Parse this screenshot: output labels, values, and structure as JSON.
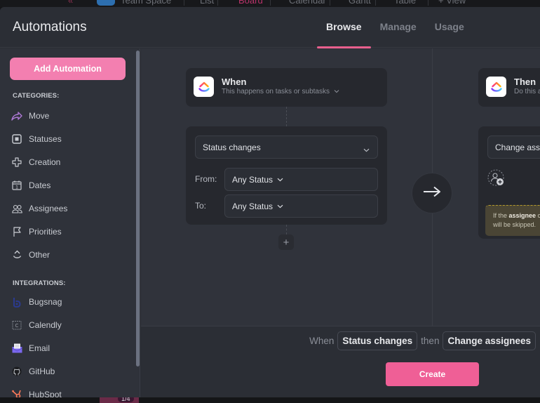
{
  "background_app": {
    "topbar": {
      "collapse_glyph": "«",
      "space_name": "Team Space",
      "views": [
        "List",
        "Board",
        "Calendar",
        "Gantt",
        "Table",
        "+ View"
      ]
    },
    "bottombar": {
      "counter": "1/4"
    }
  },
  "modal": {
    "title": "Automations",
    "tabs": [
      {
        "label": "Browse",
        "active": true
      },
      {
        "label": "Manage",
        "active": false
      },
      {
        "label": "Usage",
        "active": false
      }
    ]
  },
  "sidebar": {
    "add_button": "Add Automation",
    "categories_label": "CATEGORIES:",
    "categories": [
      {
        "label": "Move",
        "icon": "move-arrow-icon"
      },
      {
        "label": "Statuses",
        "icon": "status-square-icon"
      },
      {
        "label": "Creation",
        "icon": "plus-outline-icon"
      },
      {
        "label": "Dates",
        "icon": "calendar-icon"
      },
      {
        "label": "Assignees",
        "icon": "people-icon"
      },
      {
        "label": "Priorities",
        "icon": "flag-icon"
      },
      {
        "label": "Other",
        "icon": "other-icon"
      }
    ],
    "integrations_label": "INTEGRATIONS:",
    "integrations": [
      {
        "label": "Bugsnag",
        "icon": "bugsnag-icon"
      },
      {
        "label": "Calendly",
        "icon": "calendly-icon"
      },
      {
        "label": "Email",
        "icon": "email-icon"
      },
      {
        "label": "GitHub",
        "icon": "github-icon"
      },
      {
        "label": "HubSpot",
        "icon": "hubspot-icon"
      }
    ]
  },
  "builder": {
    "when": {
      "title": "When",
      "subtitle": "This happens on tasks or subtasks",
      "trigger": "Status changes",
      "from_label": "From:",
      "from_value": "Any Status",
      "to_label": "To:",
      "to_value": "Any Status",
      "add_condition": "+"
    },
    "then": {
      "title": "Then",
      "subtitle": "Do this a",
      "action": "Change assig",
      "warning_prefix": "If the ",
      "warning_bold": "assignee",
      "warning_suffix": " c",
      "warning_line2": "will be skipped."
    }
  },
  "footer": {
    "when_word": "When",
    "trigger_chip": "Status changes",
    "then_word": "then",
    "action_chip": "Change assignees",
    "create_button": "Create"
  },
  "colors": {
    "accent_pink": "#f37fb0",
    "create_pink": "#ef5f96",
    "tab_underline": "#e8608e",
    "move_icon": "#b07ad8",
    "email_icon": "#7b68ee",
    "hubspot_icon": "#ff7a59",
    "bugsnag_icon": "#2b3a8f"
  }
}
